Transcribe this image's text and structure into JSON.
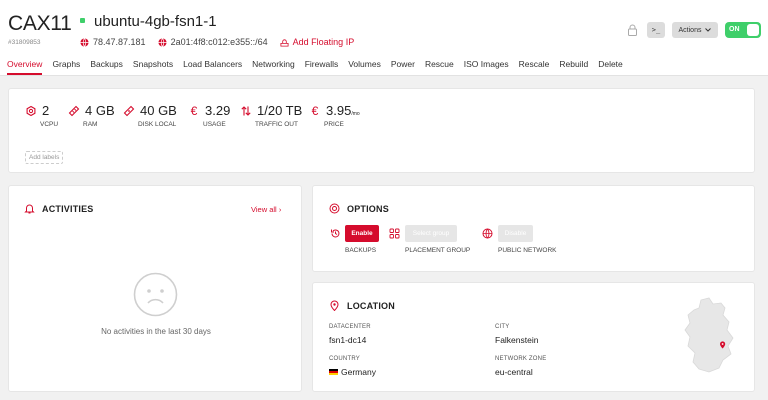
{
  "server": {
    "type": "CAX11",
    "id": "#31809853",
    "name": "ubuntu-4gb-fsn1-1",
    "ipv4": "78.47.87.181",
    "ipv6": "2a01:4f8:c012:e355::/64",
    "add_floating_ip": "Add Floating IP"
  },
  "toolbar": {
    "console_label": ">_",
    "actions_label": "Actions",
    "power_label": "ON"
  },
  "tabs": [
    "Overview",
    "Graphs",
    "Backups",
    "Snapshots",
    "Load Balancers",
    "Networking",
    "Firewalls",
    "Volumes",
    "Power",
    "Rescue",
    "ISO Images",
    "Rescale",
    "Rebuild",
    "Delete"
  ],
  "active_tab": "Overview",
  "stats": [
    {
      "icon": "cpu-icon",
      "value": "2",
      "unit": "",
      "label": "VCPU"
    },
    {
      "icon": "ram-icon",
      "value": "4 GB",
      "unit": "",
      "label": "RAM"
    },
    {
      "icon": "disk-icon",
      "value": "40 GB",
      "unit": "",
      "label": "DISK LOCAL"
    },
    {
      "icon": "euro-icon",
      "value": "3.29",
      "unit": "",
      "label": "USAGE"
    },
    {
      "icon": "traffic-icon",
      "value": "1/20 TB",
      "unit": "",
      "label": "TRAFFIC OUT"
    },
    {
      "icon": "euro-icon",
      "value": "3.95",
      "unit": "/mo",
      "label": "PRICE"
    }
  ],
  "add_labels": "Add labels",
  "activities": {
    "title": "ACTIVITIES",
    "view_all": "View all",
    "empty_text": "No activities in the last 30 days"
  },
  "options": {
    "title": "OPTIONS",
    "backups_button": "Enable",
    "backups_label": "BACKUPS",
    "placement_button": "Select group",
    "placement_label": "PLACEMENT GROUP",
    "public_button": "Disable",
    "public_label": "PUBLIC NETWORK"
  },
  "location": {
    "title": "LOCATION",
    "datacenter_key": "DATACENTER",
    "datacenter": "fsn1-dc14",
    "city_key": "CITY",
    "city": "Falkenstein",
    "country_key": "COUNTRY",
    "country": "Germany",
    "zone_key": "NETWORK ZONE",
    "zone": "eu-central"
  },
  "colors": {
    "accent": "#d50c2d",
    "status_running": "#3fcf6a",
    "background": "#f1f1f1"
  }
}
